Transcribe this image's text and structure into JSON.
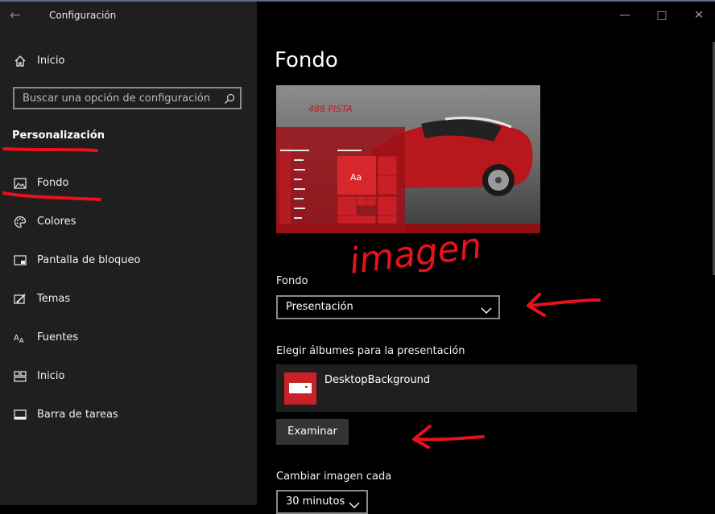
{
  "window": {
    "title": "Configuración"
  },
  "sidebar": {
    "home_label": "Inicio",
    "search_placeholder": "Buscar una opción de configuración",
    "section_title": "Personalización",
    "items": [
      {
        "label": "Fondo",
        "icon": "picture-icon",
        "selected": true
      },
      {
        "label": "Colores",
        "icon": "palette-icon"
      },
      {
        "label": "Pantalla de bloqueo",
        "icon": "lock-screen-icon"
      },
      {
        "label": "Temas",
        "icon": "themes-icon"
      },
      {
        "label": "Fuentes",
        "icon": "fonts-icon"
      },
      {
        "label": "Inicio",
        "icon": "start-icon"
      },
      {
        "label": "Barra de tareas",
        "icon": "taskbar-icon"
      }
    ]
  },
  "main": {
    "title": "Fondo",
    "preview": {
      "car_brand_text": "488 PISTA",
      "tile_text": "Aa"
    },
    "background_label": "Fondo",
    "background_value": "Presentación",
    "albums_label": "Elegir álbumes para la presentación",
    "album_name": "DesktopBackground",
    "browse_label": "Examinar",
    "interval_label": "Cambiar imagen cada",
    "interval_value": "30 minutos"
  },
  "annotations": {
    "handwritten_text": "imagen",
    "color": "#e8121b"
  },
  "colors": {
    "accent": "#c82128",
    "sidebar_bg": "#1f1f1f",
    "main_bg": "#000000"
  }
}
